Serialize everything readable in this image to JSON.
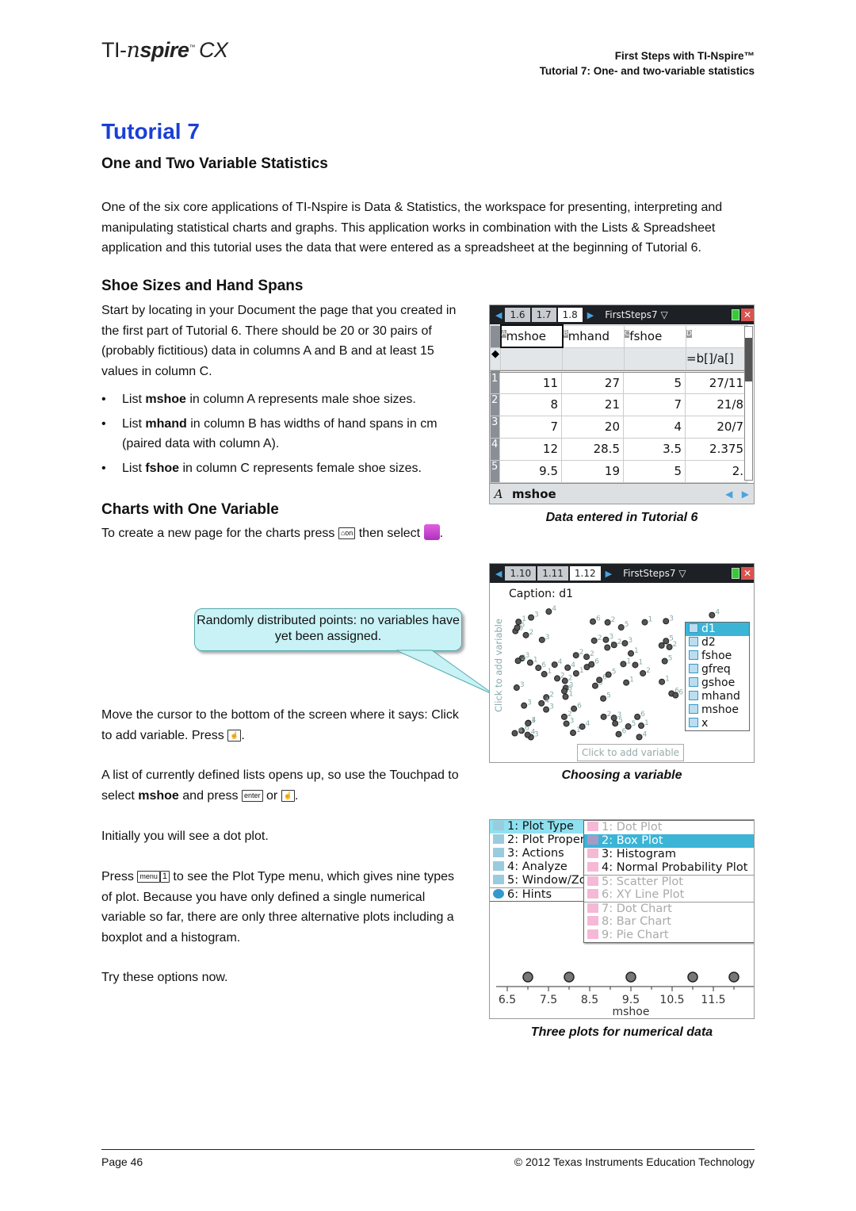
{
  "header": {
    "logo": "TI-nspire CX",
    "line1": "First Steps with TI-Nspire™",
    "line2": "Tutorial 7: One- and two-variable statistics"
  },
  "title": "Tutorial 7",
  "subtitle": "One and Two Variable Statistics",
  "intro": "One of the six core applications of TI-Nspire is Data & Statistics, the workspace for presenting, interpreting and manipulating statistical charts and graphs. This application works in combination with the Lists & Spreadsheet application and this tutorial uses the data that were entered as a spreadsheet at the beginning of Tutorial 6.",
  "section1": {
    "heading": "Shoe Sizes and Hand Spans",
    "para": "Start by locating in your Document the page that you created in the first part of Tutorial 6. There should be 20 or 30 pairs of (probably fictitious) data in columns A and B and at least 15 values in column C.",
    "bullets": [
      {
        "pre": "List ",
        "bold": "mshoe",
        "post": " in column A represents male shoe sizes."
      },
      {
        "pre": "List ",
        "bold": "mhand",
        "post": " in column B has widths of hand spans in cm (paired data with column A)."
      },
      {
        "pre": "List ",
        "bold": "fshoe",
        "post": " in column C represents female shoe sizes."
      }
    ]
  },
  "section2": {
    "heading": "Charts with One Variable",
    "p1_a": "To create a new page for the charts press ",
    "key_home": "⌂on",
    "p1_b": " then select ",
    "p1_c": ".",
    "callout": "Randomly distributed points: no variables have yet been assigned.",
    "p2_a": "Move the cursor to the bottom of the screen where it says: Click to add variable. Press ",
    "p2_b": ".",
    "p3_a": "A list of currently defined lists opens up, so use the Touchpad to select ",
    "p3_bold": "mshoe",
    "p3_b": " and press ",
    "key_enter": "enter",
    "p3_c": " or ",
    "p3_d": ".",
    "p4": "Initially you will see a dot plot.",
    "p5_a": "Press ",
    "key_menu": "menu",
    "key_1": "1",
    "p5_b": " to see the Plot Type menu, which gives nine types of plot. Because you have only defined a single numerical variable so far, there are only three alternative plots including a boxplot and a histogram.",
    "p6": "Try these options now."
  },
  "screen1": {
    "tabs": [
      "1.6",
      "1.7",
      "1.8"
    ],
    "doc": "FirstSteps7",
    "cols": [
      {
        "letter": "A",
        "name": "mshoe"
      },
      {
        "letter": "B",
        "name": "mhand"
      },
      {
        "letter": "C",
        "name": "fshoe"
      },
      {
        "letter": "D",
        "name": ""
      }
    ],
    "formula": "=b[]/a[]",
    "rows": [
      [
        "1",
        "11",
        "27",
        "5",
        "27/11"
      ],
      [
        "2",
        "8",
        "21",
        "7",
        "21/8"
      ],
      [
        "3",
        "7",
        "20",
        "4",
        "20/7"
      ],
      [
        "4",
        "12",
        "28.5",
        "3.5",
        "2.375"
      ],
      [
        "5",
        "9.5",
        "19",
        "5",
        "2."
      ]
    ],
    "bottom_letter": "A",
    "bottom_name": "mshoe",
    "caption": "Data entered in Tutorial 6"
  },
  "screen2": {
    "tabs": [
      "1.10",
      "1.11",
      "1.12"
    ],
    "doc": "FirstSteps7",
    "caption_text": "Caption: d1",
    "side_label": "Click to add variable",
    "bottom_label": "Click to add variable",
    "lists": [
      "d1",
      "d2",
      "fshoe",
      "gfreq",
      "gshoe",
      "mhand",
      "mshoe",
      "x"
    ],
    "selected": "d1",
    "caption": "Choosing a variable"
  },
  "screen3": {
    "menu": [
      "1: Plot Type",
      "2: Plot Proper",
      "3: Actions",
      "4: Analyze",
      "5: Window/Zo",
      "6: Hints"
    ],
    "submenu": [
      {
        "label": "1: Dot Plot",
        "state": "disabled"
      },
      {
        "label": "2: Box Plot",
        "state": "selected"
      },
      {
        "label": "3: Histogram",
        "state": "enabled"
      },
      {
        "label": "4: Normal Probability Plot",
        "state": "enabled"
      },
      {
        "label": "5: Scatter Plot",
        "state": "disabled"
      },
      {
        "label": "6: XY Line Plot",
        "state": "disabled"
      },
      {
        "label": "7: Dot Chart",
        "state": "disabled"
      },
      {
        "label": "8: Bar Chart",
        "state": "disabled"
      },
      {
        "label": "9: Pie Chart",
        "state": "disabled"
      }
    ],
    "ticks": [
      "6.5",
      "7.5",
      "8.5",
      "9.5",
      "10.5",
      "11.5"
    ],
    "xlabel": "mshoe",
    "points": [
      7,
      8,
      9.5,
      11,
      12
    ],
    "caption": "Three plots for numerical data"
  },
  "footer": {
    "page": "Page  46",
    "copyright": "© 2012 Texas Instruments Education Technology"
  },
  "colors": {
    "title": "#1a3fd6",
    "selection": "#3bb4d6",
    "callout": "#c8f2f6"
  }
}
